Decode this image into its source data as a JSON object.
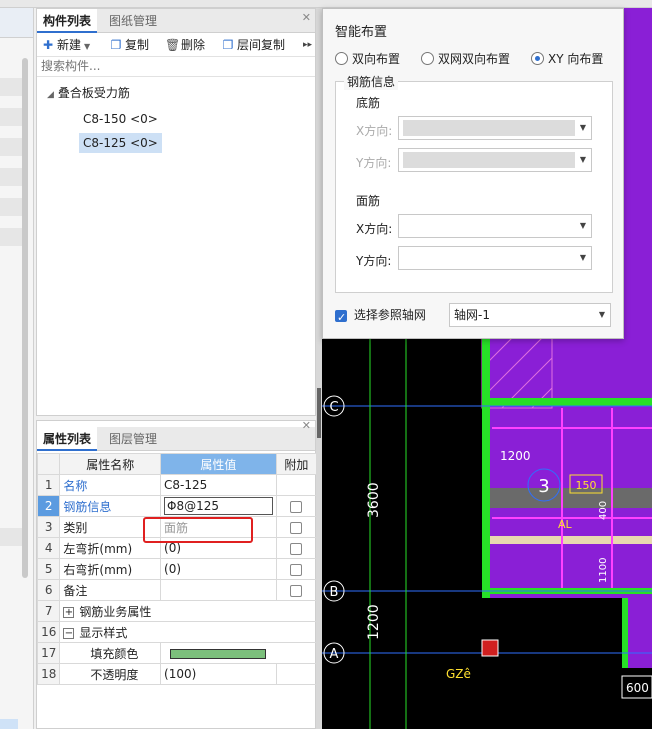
{
  "component_panel": {
    "tab_active": "构件列表",
    "tab_inactive": "图纸管理",
    "toolbar": {
      "new_label": "新建",
      "copy_label": "复制",
      "delete_label": "删除",
      "floor_copy_label": "层间复制"
    },
    "search_placeholder": "搜索构件...",
    "tree": {
      "group_label": "叠合板受力筋",
      "items": [
        "C8-150 <0>",
        "C8-125 <0>"
      ]
    }
  },
  "property_panel": {
    "tab_active": "属性列表",
    "tab_inactive": "图层管理",
    "headers": {
      "name": "属性名称",
      "value": "属性值",
      "extra": "附加"
    },
    "rows": [
      {
        "num": "1",
        "name": "名称",
        "value": "C8-125"
      },
      {
        "num": "2",
        "name": "钢筋信息",
        "value": "Φ8@125"
      },
      {
        "num": "3",
        "name": "类别",
        "value": "面筋"
      },
      {
        "num": "4",
        "name": "左弯折(mm)",
        "value": "(0)"
      },
      {
        "num": "5",
        "name": "右弯折(mm)",
        "value": "(0)"
      },
      {
        "num": "6",
        "name": "备注",
        "value": ""
      },
      {
        "num": "7",
        "name": "钢筋业务属性",
        "value": ""
      },
      {
        "num": "16",
        "name": "显示样式",
        "value": ""
      },
      {
        "num": "17",
        "name": "填充颜色",
        "value": ""
      },
      {
        "num": "18",
        "name": "不透明度",
        "value": "(100)"
      }
    ],
    "fill_color": "#7cc07c"
  },
  "smart_layout": {
    "title": "智能布置",
    "radio_options": [
      "双向布置",
      "双网双向布置",
      "XY 向布置"
    ],
    "selected": "XY 向布置",
    "group_title": "钢筋信息",
    "bottom_label": "底筋",
    "top_label": "面筋",
    "x_dir_label": "X方向:",
    "y_dir_label": "Y方向:",
    "ref_grid_checkbox": "选择参照轴网",
    "ref_grid_value": "轴网-1"
  },
  "cad": {
    "axis_labels": [
      "C",
      "B",
      "A"
    ],
    "dimensions": [
      "3600",
      "1200",
      "1200",
      "150",
      "400",
      "1100",
      "600"
    ],
    "room_number": "3",
    "beam_label": "AL",
    "column_label": "GZê"
  },
  "colors": {
    "accent": "#2f6fce",
    "cad_background": "#000000",
    "cad_purple": "#8a1fd6",
    "cad_green": "#27e027",
    "highlight_red": "#e02020"
  }
}
